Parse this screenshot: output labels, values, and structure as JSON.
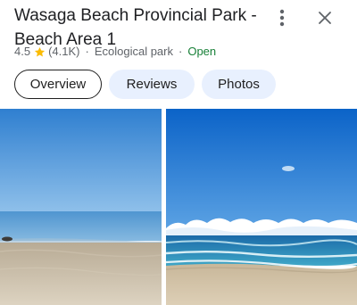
{
  "place": {
    "name": "Wasaga Beach Provincial Park - Beach Area 1",
    "rating": "4.5",
    "review_count": "(4.1K)",
    "category": "Ecological park",
    "status": "Open",
    "separator": "·"
  },
  "icons": {
    "menu": "more-vert-icon",
    "close": "close-icon",
    "star": "star-icon"
  },
  "tabs": [
    {
      "label": "Overview",
      "active": true
    },
    {
      "label": "Reviews",
      "active": false
    },
    {
      "label": "Photos",
      "active": false
    }
  ],
  "photos": [
    {
      "subject": "beach-shoreline-calm"
    },
    {
      "subject": "beach-waves-clouds"
    }
  ],
  "colors": {
    "text": "#202124",
    "secondary": "#5f6368",
    "open": "#188038",
    "star": "#fbbc04",
    "chip_bg": "#e8f0fe"
  }
}
